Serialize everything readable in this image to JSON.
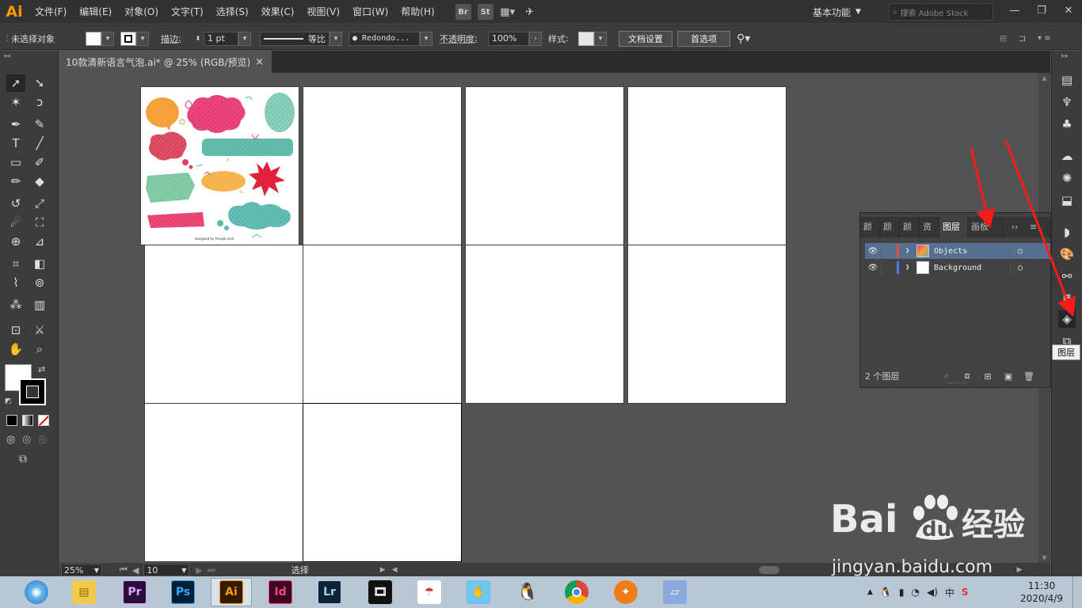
{
  "menubar": {
    "logo": "Ai",
    "items": [
      "文件(F)",
      "编辑(E)",
      "对象(O)",
      "文字(T)",
      "选择(S)",
      "效果(C)",
      "视图(V)",
      "窗口(W)",
      "帮助(H)"
    ],
    "bridge": "Br",
    "stock": "St",
    "workspace": "基本功能",
    "search_placeholder": "搜索 Adobe Stock"
  },
  "control_bar": {
    "selection_status": "未选择对象",
    "stroke_label": "描边",
    "stroke_weight": "1 pt",
    "stroke_profile": "等比",
    "brush": "Redondo...",
    "opacity_label": "不透明度",
    "opacity_value": "100%",
    "style_label": "样式",
    "doc_settings": "文档设置",
    "preferences": "首选项"
  },
  "document_tab": {
    "title": "10款清新语言气泡.ai* @ 25% (RGB/预览)",
    "close": "×"
  },
  "artwork": {
    "credit": "designed by freepik.com"
  },
  "layers_panel": {
    "tabs": [
      "颜",
      "颜",
      "颜",
      "资",
      "图层",
      "画板"
    ],
    "active_tab": "图层",
    "layers": [
      {
        "name": "Objects",
        "color": "#e85050"
      },
      {
        "name": "Background",
        "color": "#4f7fe0"
      }
    ],
    "layer_count": "2 个图层"
  },
  "tooltip": "图层",
  "status_bar": {
    "zoom": "25%",
    "artboard_number": "10",
    "tool_status": "选择"
  },
  "taskbar": {
    "apps": [
      {
        "label": "Pr",
        "bg": "#2a0f3d",
        "fg": "#e2a5ff"
      },
      {
        "label": "Ps",
        "bg": "#041e36",
        "fg": "#31a8ff"
      },
      {
        "label": "Ai",
        "bg": "#331b00",
        "fg": "#ff9a00"
      },
      {
        "label": "Id",
        "bg": "#3b0a1f",
        "fg": "#ff3d8d"
      },
      {
        "label": "Lr",
        "bg": "#0f2433",
        "fg": "#9cd3ff"
      }
    ],
    "clock_time": "11:30",
    "clock_date": "2020/4/9",
    "ime": "中"
  },
  "watermark": {
    "brand": "Bai",
    "brand2": "经验",
    "url": "jingyan.baidu.com"
  },
  "colors": {
    "accent_orange": "#ff9a00",
    "annotation_red": "#ff1a1a",
    "selected_layer_bg": "#55708f"
  }
}
